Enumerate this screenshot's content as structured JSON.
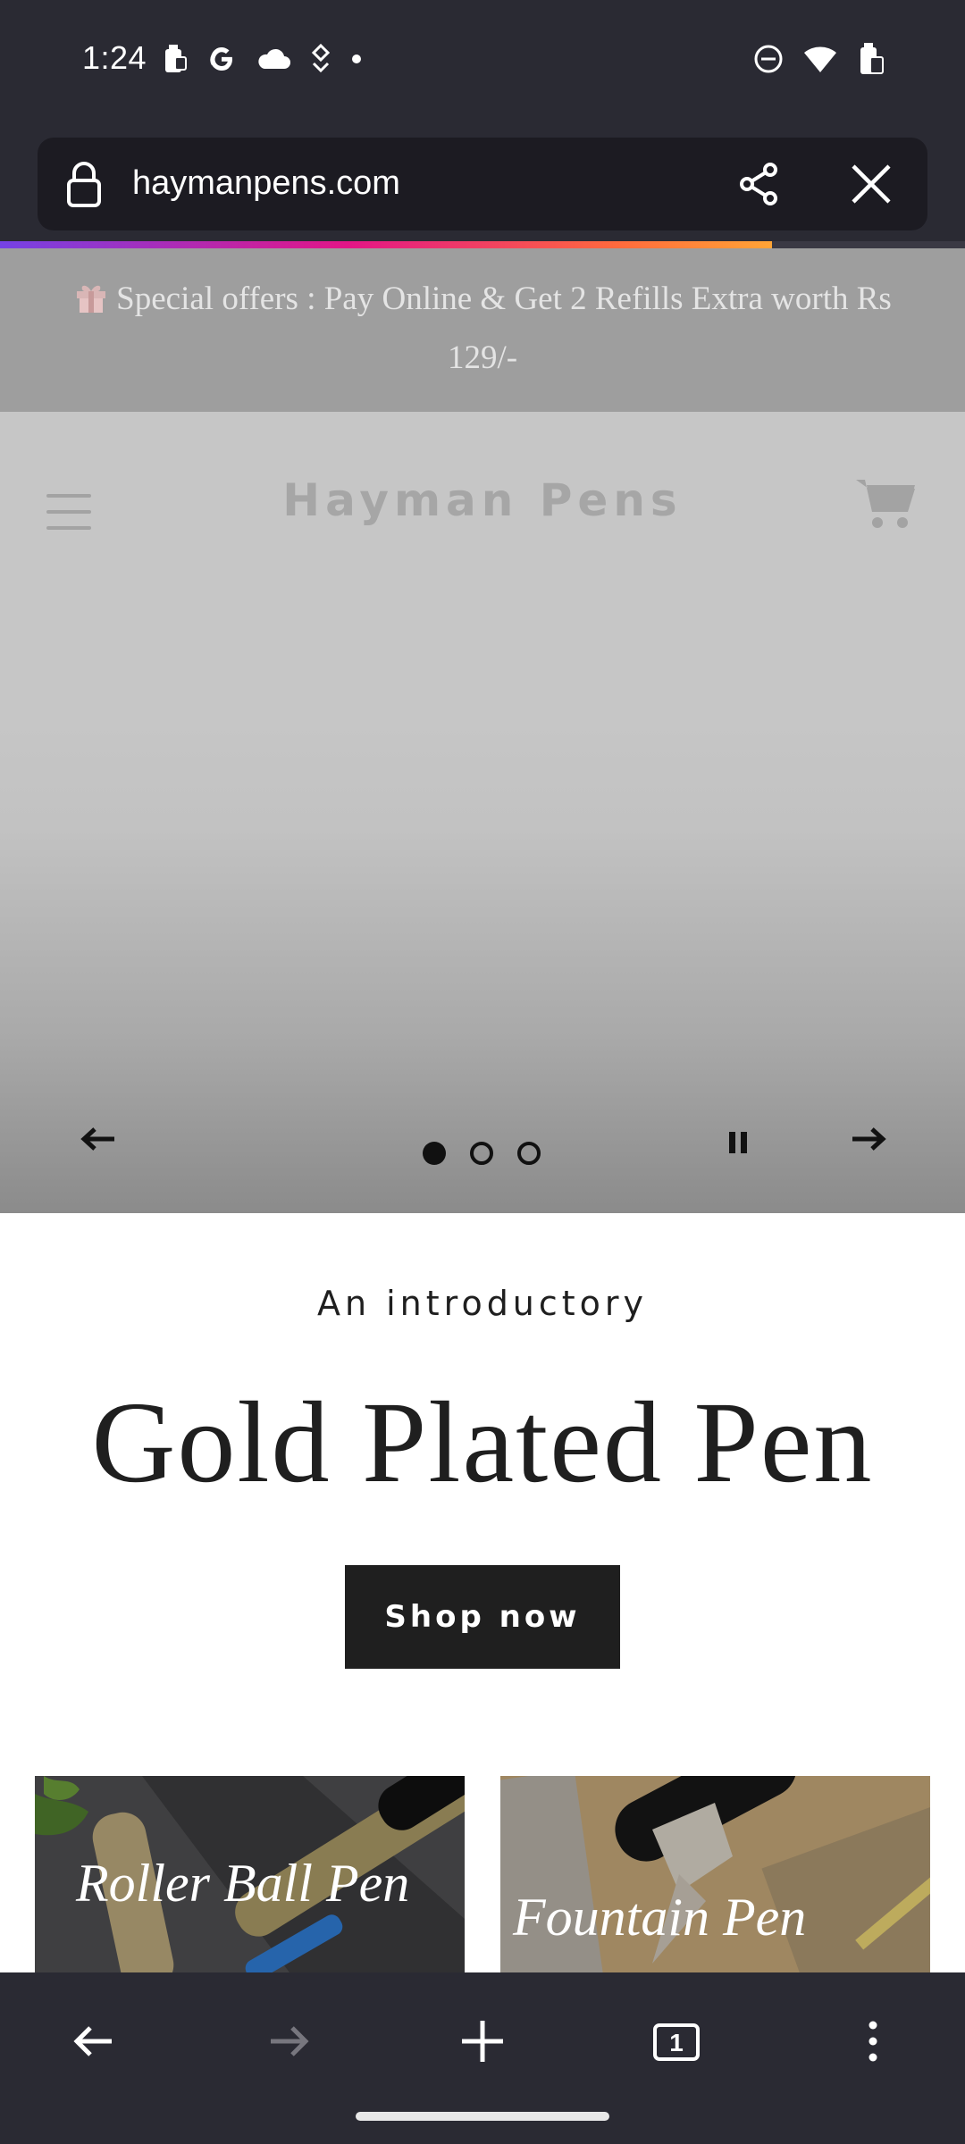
{
  "status_bar": {
    "time": "1:24",
    "left_icons": [
      "battery-saver-icon",
      "google-icon",
      "cloud-icon",
      "location-pin-icon",
      "dot-icon"
    ],
    "right_icons": [
      "do-not-disturb-icon",
      "wifi-icon",
      "battery-icon"
    ]
  },
  "browser": {
    "url": "haymanpens.com",
    "load_progress_percent": 80,
    "icons": {
      "lock": "lock-icon",
      "share": "share-icon",
      "close": "close-icon"
    }
  },
  "announcement": {
    "text": "Special offers : Pay Online & Get 2 Refills Extra worth Rs 129/-",
    "icon": "gift-icon"
  },
  "header": {
    "brand": "Hayman Pens",
    "menu_icon": "hamburger-menu-icon",
    "cart_icon": "cart-icon"
  },
  "slideshow": {
    "slide_count": 3,
    "active_slide": 1,
    "controls": [
      "previous-arrow-icon",
      "pause-icon",
      "next-arrow-icon"
    ]
  },
  "promo": {
    "eyebrow": "An introductory",
    "headline": "Gold Plated Pen",
    "button": "Shop now"
  },
  "collections": [
    {
      "label": "Roller Ball Pen"
    },
    {
      "label": "Fountain Pen"
    }
  ],
  "bottom_nav": {
    "icons": [
      "back-arrow-icon",
      "forward-arrow-icon",
      "new-tab-plus-icon",
      "tab-count-icon",
      "overflow-menu-icon"
    ],
    "tab_count": "1"
  },
  "colors": {
    "chrome_bg": "#2a2a33",
    "url_field_bg": "#1c1b22",
    "announcement_bg": "#9e9e9e",
    "hero_bg": "#c6c6c6",
    "button_bg": "#1f1f1f"
  }
}
